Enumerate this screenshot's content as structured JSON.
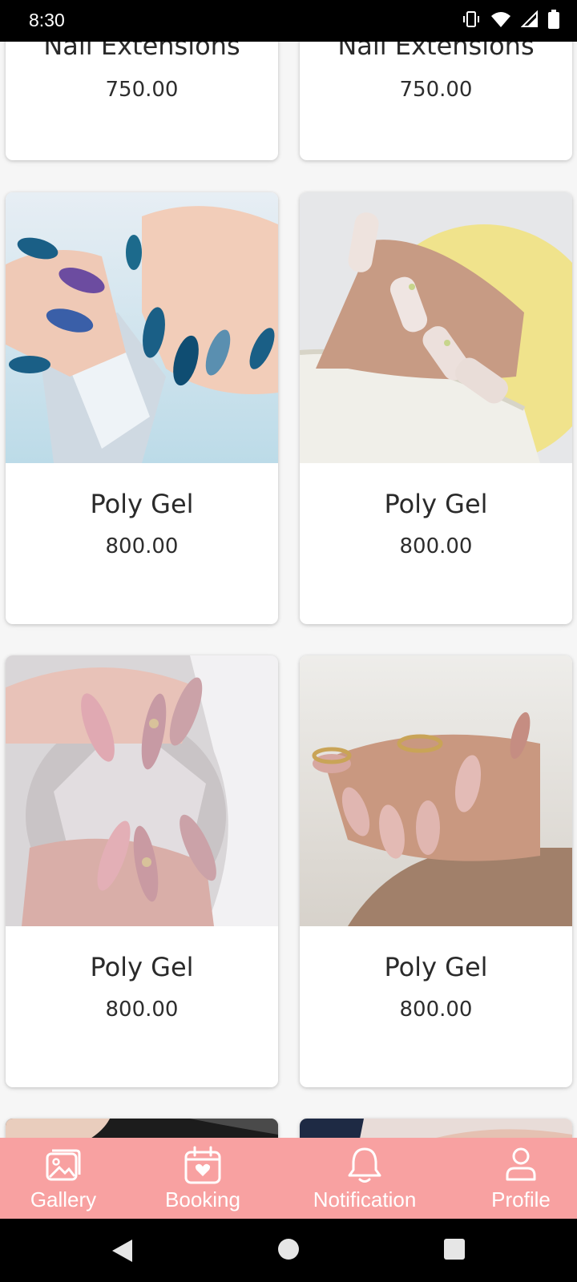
{
  "status_bar": {
    "time": "8:30"
  },
  "cards": [
    {
      "title": "Nail Extensions",
      "price": "750.00"
    },
    {
      "title": "Nail Extensions",
      "price": "750.00"
    },
    {
      "title": "Poly Gel",
      "price": "800.00"
    },
    {
      "title": "Poly Gel",
      "price": "800.00"
    },
    {
      "title": "Poly Gel",
      "price": "800.00"
    },
    {
      "title": "Poly Gel",
      "price": "800.00"
    }
  ],
  "bottom_nav": {
    "items": [
      {
        "label": "Gallery",
        "icon": "gallery-icon"
      },
      {
        "label": "Booking",
        "icon": "booking-calendar-icon"
      },
      {
        "label": "Notification",
        "icon": "bell-icon"
      },
      {
        "label": "Profile",
        "icon": "profile-icon"
      }
    ]
  },
  "colors": {
    "nav_background": "#f8a1a1",
    "page_background": "#f6f6f6"
  }
}
